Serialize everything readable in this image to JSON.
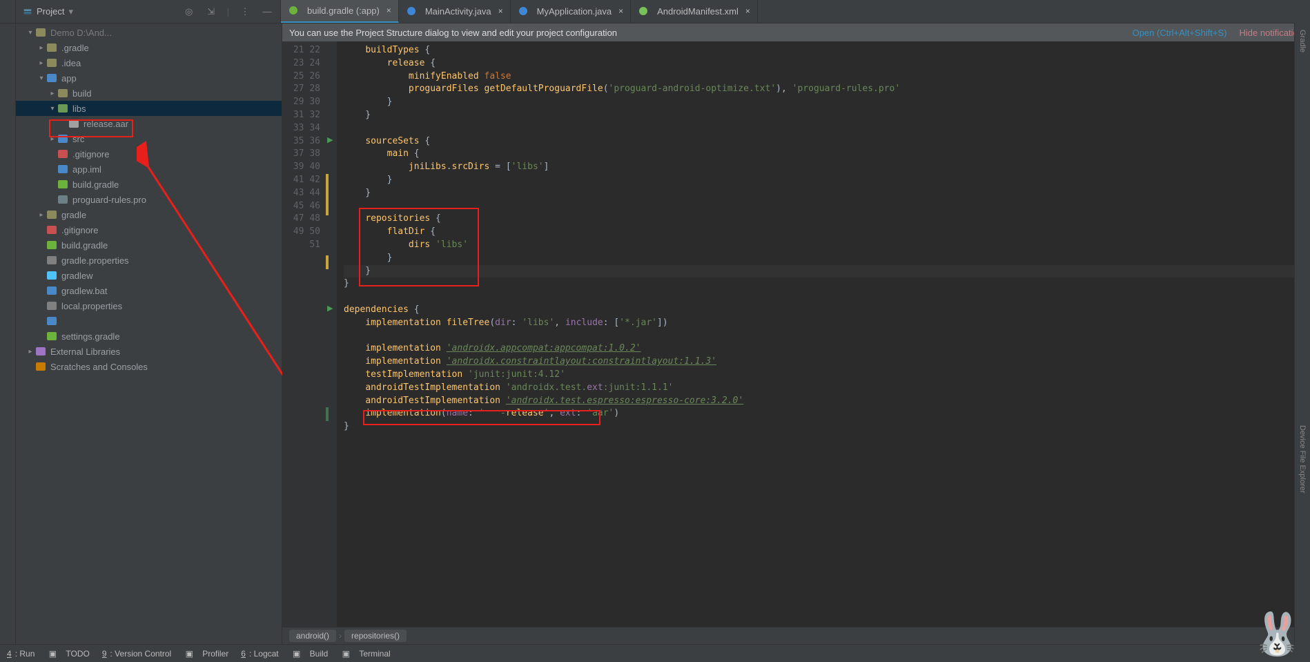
{
  "header": {
    "project_label": "Project"
  },
  "topicons": [
    "target",
    "collapse",
    "divider",
    "ellipsis",
    "minimize"
  ],
  "tabs": [
    {
      "icon": "gradle",
      "label": "build.gradle (:app)",
      "active": true
    },
    {
      "icon": "java",
      "label": "MainActivity.java"
    },
    {
      "icon": "java",
      "label": "MyApplication.java"
    },
    {
      "icon": "android",
      "label": "AndroidManifest.xml"
    }
  ],
  "banner": {
    "msg": "You can use the Project Structure dialog to view and edit your project configuration",
    "open": "Open (Ctrl+Alt+Shift+S)",
    "hide": "Hide notification"
  },
  "tree": [
    {
      "d": 0,
      "arr": "v",
      "ic": "folder",
      "txt": "Demo  D:\\And...",
      "grey": true
    },
    {
      "d": 1,
      "arr": ">",
      "ic": "folder",
      "txt": ".gradle"
    },
    {
      "d": 1,
      "arr": ">",
      "ic": "folder",
      "txt": ".idea"
    },
    {
      "d": 1,
      "arr": "v",
      "ic": "module",
      "txt": "app"
    },
    {
      "d": 2,
      "arr": ">",
      "ic": "folder",
      "txt": "build"
    },
    {
      "d": 2,
      "arr": "v",
      "ic": "folder-g",
      "txt": "libs",
      "sel": true
    },
    {
      "d": 3,
      "arr": " ",
      "ic": "snow",
      "txt": "release.aar",
      "boxed": true
    },
    {
      "d": 2,
      "arr": ">",
      "ic": "folder-b",
      "txt": "src"
    },
    {
      "d": 2,
      "arr": " ",
      "ic": "git",
      "txt": ".gitignore"
    },
    {
      "d": 2,
      "arr": " ",
      "ic": "iml",
      "txt": "app.iml"
    },
    {
      "d": 2,
      "arr": " ",
      "ic": "gradle",
      "txt": "build.gradle"
    },
    {
      "d": 2,
      "arr": " ",
      "ic": "owl",
      "txt": "proguard-rules.pro"
    },
    {
      "d": 1,
      "arr": ">",
      "ic": "folder",
      "txt": "gradle"
    },
    {
      "d": 1,
      "arr": " ",
      "ic": "git",
      "txt": ".gitignore"
    },
    {
      "d": 1,
      "arr": " ",
      "ic": "gradle",
      "txt": "build.gradle"
    },
    {
      "d": 1,
      "arr": " ",
      "ic": "gear",
      "txt": "gradle.properties"
    },
    {
      "d": 1,
      "arr": " ",
      "ic": "sh",
      "txt": "gradlew"
    },
    {
      "d": 1,
      "arr": " ",
      "ic": "bat",
      "txt": "gradlew.bat"
    },
    {
      "d": 1,
      "arr": " ",
      "ic": "gear",
      "txt": "local.properties"
    },
    {
      "d": 1,
      "arr": " ",
      "ic": "iml",
      "txt": ""
    },
    {
      "d": 1,
      "arr": " ",
      "ic": "gradle",
      "txt": "settings.gradle"
    },
    {
      "d": 0,
      "arr": ">",
      "ic": "lib",
      "txt": "External Libraries"
    },
    {
      "d": 0,
      "arr": " ",
      "ic": "scratch",
      "txt": "Scratches and Consoles"
    }
  ],
  "code": {
    "start": 21,
    "lines": [
      "    buildTypes {",
      "        release {",
      "            minifyEnabled false",
      "            proguardFiles getDefaultProguardFile('proguard-android-optimize.txt'), 'proguard-rules.pro'",
      "        }",
      "    }",
      "",
      "    sourceSets {",
      "        main {",
      "            jniLibs.srcDirs = ['libs']",
      "        }",
      "    }",
      "",
      "    repositories {",
      "        flatDir {",
      "            dirs 'libs'",
      "        }",
      "    }",
      "}",
      "",
      "dependencies {",
      "    implementation fileTree(dir: 'libs', include: ['*.jar'])",
      "",
      "    implementation 'androidx.appcompat:appcompat:1.0.2'",
      "    implementation 'androidx.constraintlayout:constraintlayout:1.1.3'",
      "    testImplementation 'junit:junit:4.12'",
      "    androidTestImplementation 'androidx.test.ext:junit:1.1.1'",
      "    androidTestImplementation 'androidx.test.espresso:espresso-core:3.2.0'",
      "    implementation(name: '   -release', ext: 'aar')",
      "}",
      ""
    ],
    "run_gutters": [
      28,
      41
    ],
    "cursor_line": 38
  },
  "breadcrumb": [
    "android()",
    "repositories()"
  ],
  "bottom": [
    {
      "num": "4",
      "label": "Run"
    },
    {
      "num": "",
      "label": "TODO",
      "ic": "todo"
    },
    {
      "num": "9",
      "label": "Version Control"
    },
    {
      "num": "",
      "label": "Profiler",
      "ic": "profiler"
    },
    {
      "num": "6",
      "label": "Logcat"
    },
    {
      "num": "",
      "label": "Build",
      "ic": "build"
    },
    {
      "num": "",
      "label": "Terminal",
      "ic": "term"
    }
  ],
  "rightrail": [
    "Gradle",
    "Device File Explorer"
  ]
}
